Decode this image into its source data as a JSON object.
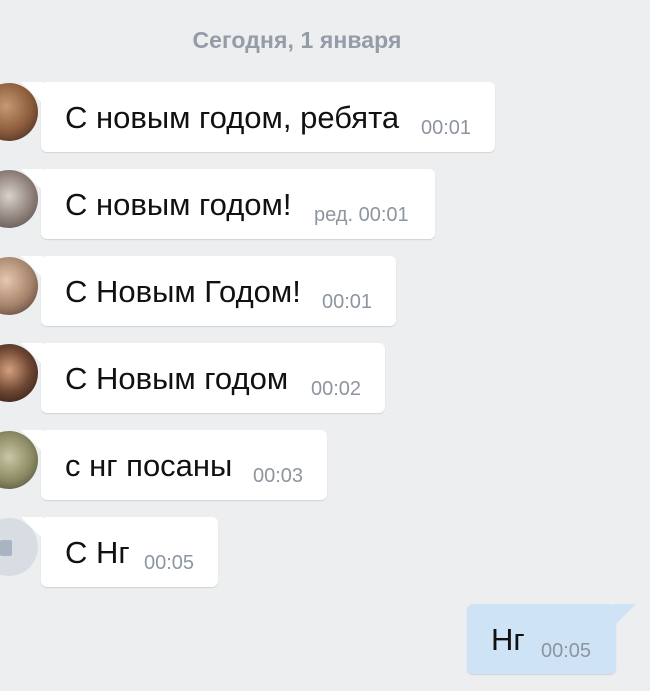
{
  "chat": {
    "date_separator": "Сегодня, 1 января",
    "messages": [
      {
        "text": "С новым годом, ребята",
        "time": "00:01",
        "direction": "in"
      },
      {
        "text": "С новым годом!",
        "time": "ред. 00:01",
        "direction": "in"
      },
      {
        "text": "С Новым Годом!",
        "time": "00:01",
        "direction": "in"
      },
      {
        "text": "С Новым годом",
        "time": "00:02",
        "direction": "in"
      },
      {
        "text": "с нг посаны",
        "time": "00:03",
        "direction": "in"
      },
      {
        "text": "С Нг",
        "time": "00:05",
        "direction": "in"
      },
      {
        "text": "Нг",
        "time": "00:05",
        "direction": "out"
      }
    ]
  },
  "colors": {
    "background": "#edeef0",
    "incoming_bubble": "#ffffff",
    "outgoing_bubble": "#cfe3f7",
    "time_text": "#8d959f",
    "date_text": "#939ca7"
  }
}
